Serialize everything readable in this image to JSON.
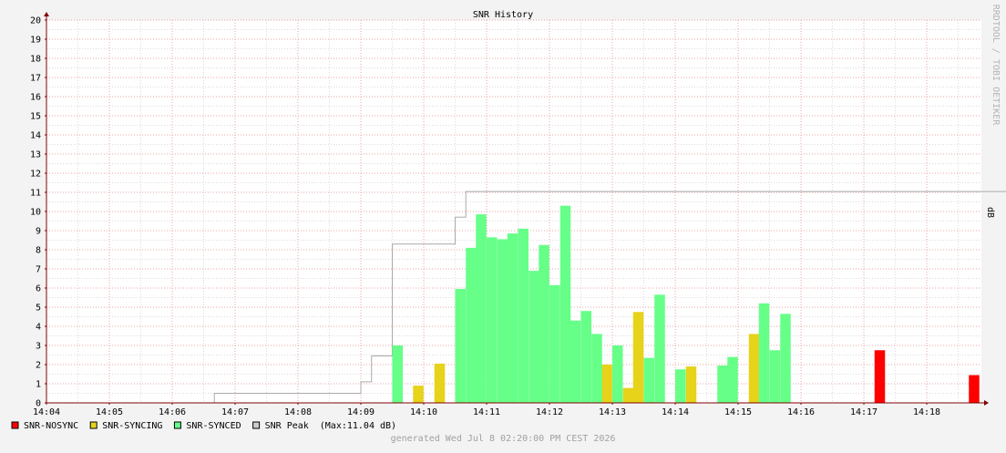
{
  "chart_data": {
    "type": "bar",
    "title": "SNR History",
    "ylabel": "dB",
    "watermark": "RRDTOOL / TOBI OETIKER",
    "footer": "generated Wed Jul  8 02:20:00 PM CEST 2026",
    "ylim": [
      0,
      20
    ],
    "xlim_minutes": [
      0,
      15.45
    ],
    "y_ticks": [
      "0",
      "1",
      "2",
      "3",
      "4",
      "5",
      "6",
      "7",
      "8",
      "9",
      "10",
      "11",
      "12",
      "13",
      "14",
      "15",
      "16",
      "17",
      "18",
      "19",
      "20"
    ],
    "x_ticks": [
      "14:04",
      "14:05",
      "14:06",
      "14:07",
      "14:08",
      "14:09",
      "14:10",
      "14:11",
      "14:12",
      "14:13",
      "14:14",
      "14:15",
      "14:16",
      "14:17",
      "14:18"
    ],
    "grid": true,
    "colors": {
      "background": "#f3f3f3",
      "plot_bg": "#ffffff",
      "grid_major": "#e8a4a4",
      "grid_minor": "#dcdcdc",
      "axis": "#800000",
      "nosync": "#ff0000",
      "syncing": "#e6d31a",
      "synced": "#66ff88",
      "peak": "#aaaaaa"
    },
    "series": [
      {
        "name": "SNR-NOSYNC",
        "color": "#ff0000",
        "points": [
          [
            13.17,
            2.75
          ],
          [
            14.67,
            1.45
          ]
        ]
      },
      {
        "name": "SNR-SYNCING",
        "color": "#e6d31a",
        "points": [
          [
            5.83,
            0.9
          ],
          [
            6.17,
            2.05
          ],
          [
            8.83,
            2.0
          ],
          [
            9.17,
            0.78
          ],
          [
            9.33,
            4.75
          ],
          [
            10.17,
            1.9
          ],
          [
            11.17,
            3.6
          ]
        ]
      },
      {
        "name": "SNR-SYNCED",
        "color": "#66ff88",
        "points": [
          [
            5.5,
            3.0
          ],
          [
            6.5,
            5.95
          ],
          [
            6.67,
            8.1
          ],
          [
            6.83,
            9.85
          ],
          [
            7.0,
            8.65
          ],
          [
            7.17,
            8.55
          ],
          [
            7.33,
            8.85
          ],
          [
            7.5,
            9.1
          ],
          [
            7.67,
            6.9
          ],
          [
            7.83,
            8.25
          ],
          [
            8.0,
            6.15
          ],
          [
            8.17,
            10.3
          ],
          [
            8.33,
            4.3
          ],
          [
            8.5,
            4.8
          ],
          [
            8.67,
            3.6
          ],
          [
            9.0,
            3.0
          ],
          [
            9.5,
            2.35
          ],
          [
            9.67,
            5.65
          ],
          [
            10.0,
            1.75
          ],
          [
            10.67,
            1.95
          ],
          [
            10.83,
            2.4
          ],
          [
            11.33,
            5.2
          ],
          [
            11.5,
            2.75
          ],
          [
            11.67,
            4.65
          ]
        ]
      }
    ],
    "peak": {
      "name": "SNR Peak",
      "max_label": "(Max:11.04 dB)",
      "color": "#aaaaaa",
      "steps": [
        [
          2.67,
          0.5
        ],
        [
          5.0,
          1.1
        ],
        [
          5.17,
          2.45
        ],
        [
          5.5,
          8.3
        ],
        [
          6.33,
          8.3
        ],
        [
          6.5,
          9.7
        ],
        [
          6.67,
          11.04
        ],
        [
          15.45,
          11.04
        ]
      ]
    },
    "legend": [
      {
        "label": "SNR-NOSYNC",
        "color": "#ff0000"
      },
      {
        "label": "SNR-SYNCING",
        "color": "#e6d31a"
      },
      {
        "label": "SNR-SYNCED",
        "color": "#66ff88"
      },
      {
        "label": "SNR Peak",
        "color": "#cccccc",
        "extra": "(Max:11.04 dB)"
      }
    ]
  }
}
